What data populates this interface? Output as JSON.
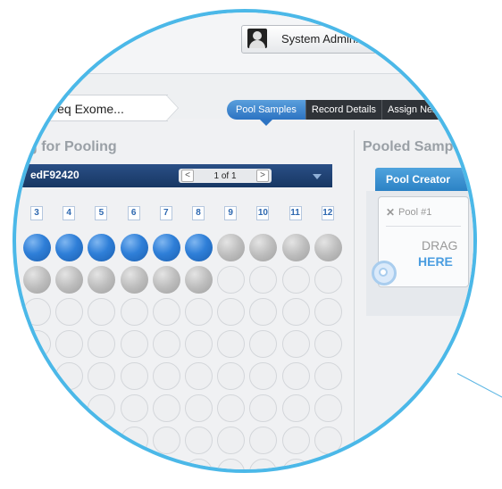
{
  "header": {
    "user_label": "System Adminis"
  },
  "breadcrumb": {
    "label": "uSeq Exome..."
  },
  "workflow_steps": [
    {
      "label": "Pool Samples",
      "active": true
    },
    {
      "label": "Record Details",
      "active": false
    },
    {
      "label": "Assign Next S",
      "active": false
    }
  ],
  "left_panel": {
    "title": "g for Pooling",
    "plate_id": "edF92420",
    "pager": {
      "prev": "<",
      "text": "1 of 1",
      "next": ">"
    },
    "columns": [
      "3",
      "4",
      "5",
      "6",
      "7",
      "8",
      "9",
      "10",
      "11",
      "12"
    ],
    "rows": [
      [
        "blue",
        "blue",
        "blue",
        "blue",
        "blue",
        "blue",
        "gray",
        "gray",
        "gray",
        "gray"
      ],
      [
        "gray",
        "gray",
        "gray",
        "gray",
        "gray",
        "gray",
        "empty",
        "empty",
        "empty",
        "empty"
      ],
      [
        "empty",
        "empty",
        "empty",
        "empty",
        "empty",
        "empty",
        "empty",
        "empty",
        "empty",
        "empty"
      ],
      [
        "empty",
        "empty",
        "empty",
        "empty",
        "empty",
        "empty",
        "empty",
        "empty",
        "empty",
        "empty"
      ],
      [
        "empty",
        "empty",
        "empty",
        "empty",
        "empty",
        "empty",
        "empty",
        "empty",
        "empty",
        "empty"
      ],
      [
        "empty",
        "empty",
        "empty",
        "empty",
        "empty",
        "empty",
        "empty",
        "empty",
        "empty",
        "empty"
      ],
      [
        "empty",
        "empty",
        "empty",
        "empty",
        "empty",
        "empty",
        "empty",
        "empty",
        "empty",
        "empty"
      ],
      [
        "empty",
        "empty",
        "empty",
        "empty",
        "empty",
        "empty",
        "empty",
        "empty",
        "empty",
        "empty"
      ]
    ]
  },
  "right_panel": {
    "title": "Pooled Samp",
    "creator_label": "Pool Creator",
    "pool": {
      "remove": "✕",
      "name": "Pool #1",
      "drag": "DRAG",
      "here": "HERE"
    },
    "pool2": {
      "remove": "✕"
    }
  },
  "colors": {
    "lens_border": "#4bb8e8",
    "plate_bar": "#1e4276",
    "active_step": "#3a86d0",
    "sample_well": "#2f7fd8"
  }
}
